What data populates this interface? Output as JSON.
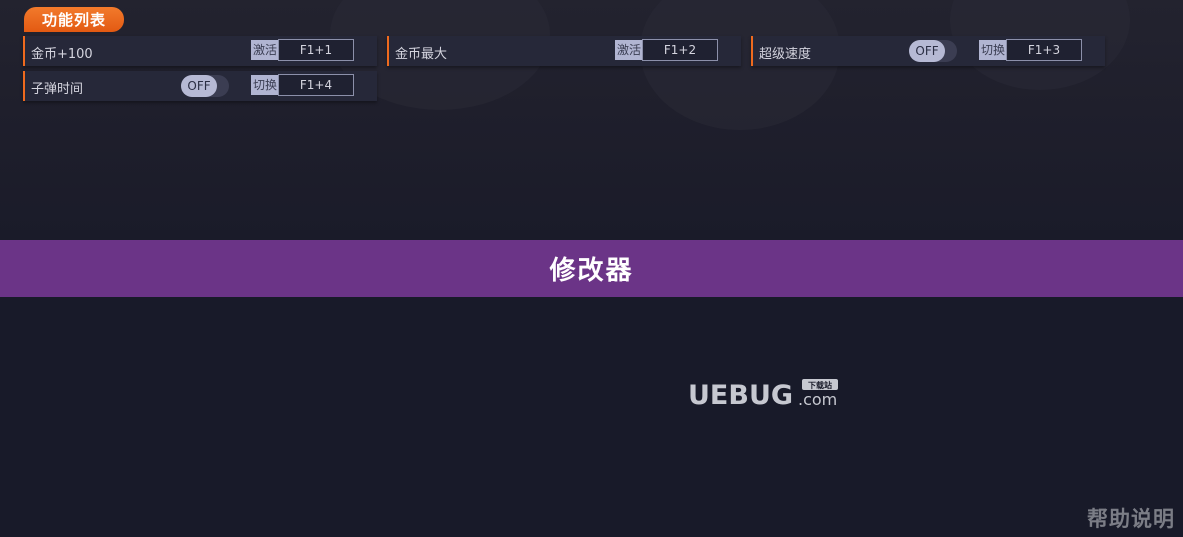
{
  "panel": {
    "title": "功能列表"
  },
  "cheats": [
    {
      "label": "金币+100",
      "mode": "激活",
      "hotkey": "F1+1"
    },
    {
      "label": "金币最大",
      "mode": "激活",
      "hotkey": "F1+2"
    },
    {
      "label": "超级速度",
      "mode": "切换",
      "hotkey": "F1+3",
      "toggle": "OFF"
    },
    {
      "label": "子弹时间",
      "mode": "切换",
      "hotkey": "F1+4",
      "toggle": "OFF"
    }
  ],
  "banner": {
    "title": "修改器"
  },
  "watermark": {
    "brand": "UEBUG",
    "suffix": ".com",
    "badge": "下载站"
  },
  "footer": {
    "help": "帮助说明"
  },
  "colors": {
    "accent": "#ef6a1e",
    "banner": "#6b3487",
    "background": "#181a29"
  }
}
